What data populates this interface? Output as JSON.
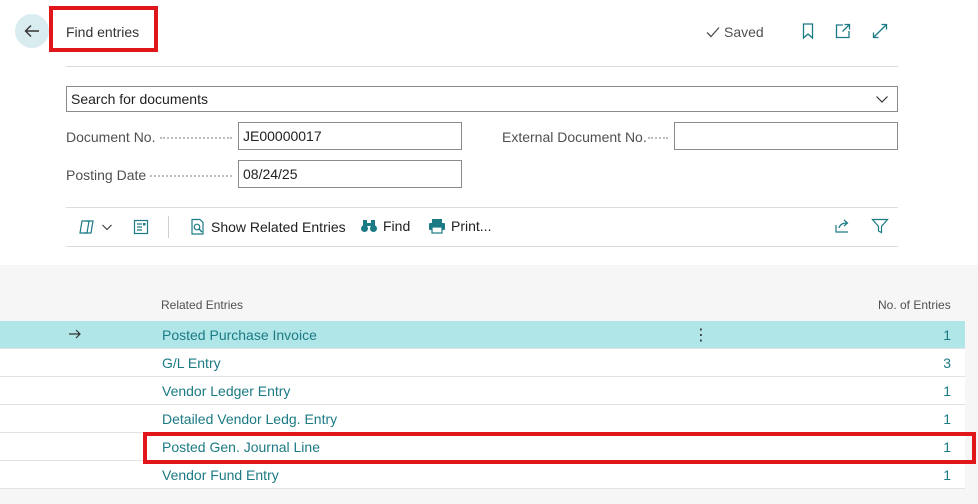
{
  "header": {
    "title": "Find entries",
    "saved_label": "Saved"
  },
  "search": {
    "value": "Search for documents"
  },
  "fields": {
    "document_no_label": "Document No.",
    "document_no_value": "JE00000017",
    "posting_date_label": "Posting Date",
    "posting_date_value": "08/24/25",
    "external_doc_label": "External Document No.",
    "external_doc_value": ""
  },
  "toolbar": {
    "show_related": "Show Related Entries",
    "find": "Find",
    "print": "Print..."
  },
  "grid": {
    "col_related": "Related Entries",
    "col_count": "No. of Entries",
    "rows": [
      {
        "name": "Posted Purchase Invoice",
        "count": "1"
      },
      {
        "name": "G/L Entry",
        "count": "3"
      },
      {
        "name": "Vendor Ledger Entry",
        "count": "1"
      },
      {
        "name": "Detailed Vendor Ledg. Entry",
        "count": "1"
      },
      {
        "name": "Posted Gen. Journal Line",
        "count": "1"
      },
      {
        "name": "Vendor Fund Entry",
        "count": "1"
      }
    ]
  },
  "colors": {
    "accent": "#1b7a84",
    "selected_row": "#b0e6e8",
    "annotation": "#e0161b"
  }
}
